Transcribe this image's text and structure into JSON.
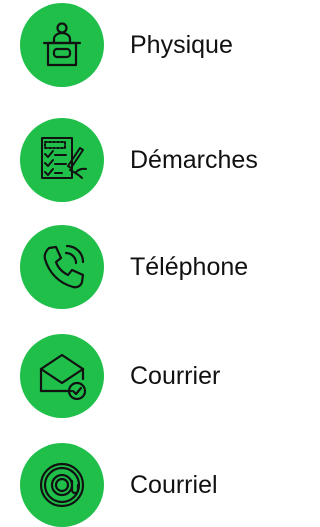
{
  "colors": {
    "accent": "#1fbf4a",
    "icon_stroke": "#111111",
    "text": "#111111"
  },
  "channels": [
    {
      "label": "Physique",
      "icon": "reception-desk-icon"
    },
    {
      "label": "Démarches",
      "icon": "form-checklist-icon"
    },
    {
      "label": "Téléphone",
      "icon": "phone-call-icon"
    },
    {
      "label": "Courrier",
      "icon": "envelope-check-icon"
    },
    {
      "label": "Courriel",
      "icon": "at-sign-icon"
    }
  ]
}
